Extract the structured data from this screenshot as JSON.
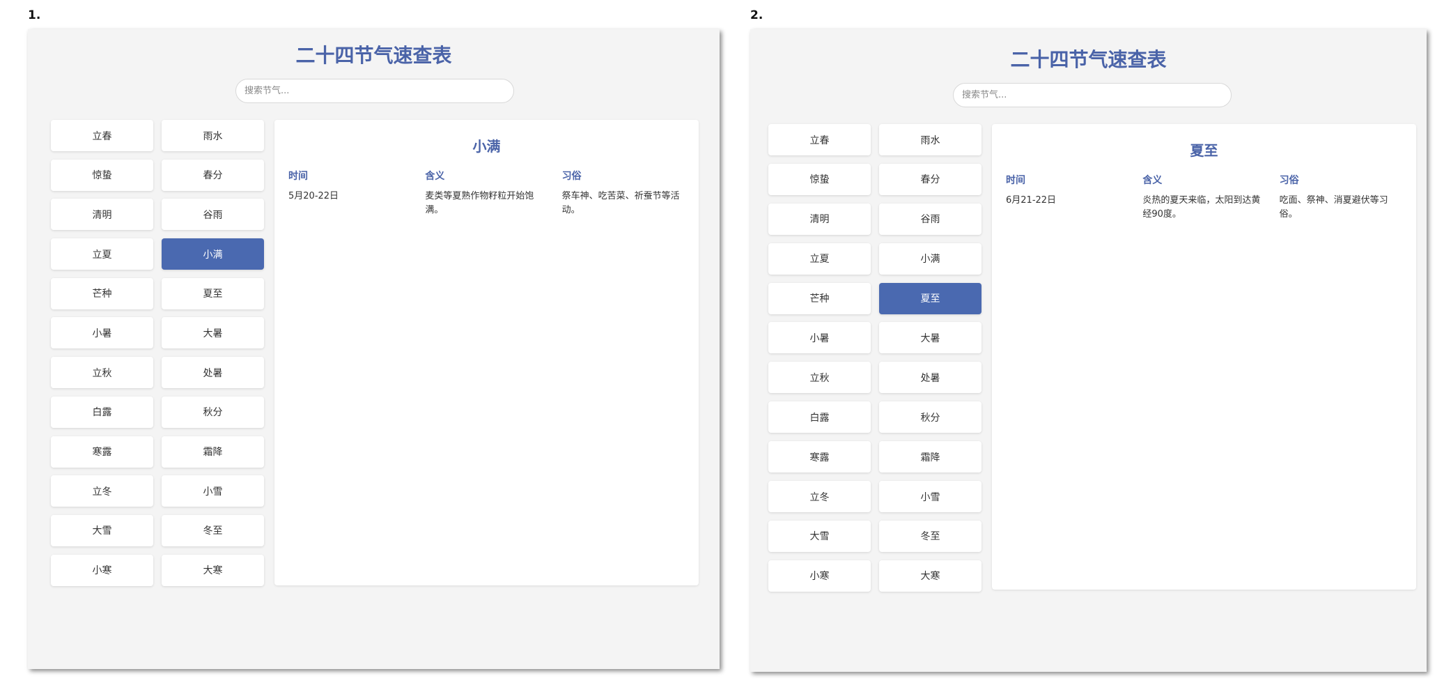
{
  "panels": [
    {
      "label": "1.",
      "title": "二十四节气速查表",
      "search_placeholder": "搜索节气...",
      "terms": [
        "立春",
        "雨水",
        "惊蛰",
        "春分",
        "清明",
        "谷雨",
        "立夏",
        "小满",
        "芒种",
        "夏至",
        "小暑",
        "大暑",
        "立秋",
        "处暑",
        "白露",
        "秋分",
        "寒露",
        "霜降",
        "立冬",
        "小雪",
        "大雪",
        "冬至",
        "小寒",
        "大寒"
      ],
      "selected_term": "小满",
      "detail": {
        "name": "小满",
        "headers": [
          "时间",
          "含义",
          "习俗"
        ],
        "values": [
          "5月20-22日",
          "麦类等夏熟作物籽粒开始饱满。",
          "祭车神、吃苦菜、祈蚕节等活动。"
        ]
      }
    },
    {
      "label": "2.",
      "title": "二十四节气速查表",
      "search_placeholder": "搜索节气...",
      "terms": [
        "立春",
        "雨水",
        "惊蛰",
        "春分",
        "清明",
        "谷雨",
        "立夏",
        "小满",
        "芒种",
        "夏至",
        "小暑",
        "大暑",
        "立秋",
        "处暑",
        "白露",
        "秋分",
        "寒露",
        "霜降",
        "立冬",
        "小雪",
        "大雪",
        "冬至",
        "小寒",
        "大寒"
      ],
      "selected_term": "夏至",
      "detail": {
        "name": "夏至",
        "headers": [
          "时间",
          "含义",
          "习俗"
        ],
        "values": [
          "6月21-22日",
          "炎热的夏天来临，太阳到达黄经90度。",
          "吃面、祭神、消夏避伏等习俗。"
        ]
      }
    }
  ],
  "colors": {
    "accent": "#4a63a8",
    "active_button": "#4a69b0",
    "window_bg": "#f4f4f4"
  }
}
